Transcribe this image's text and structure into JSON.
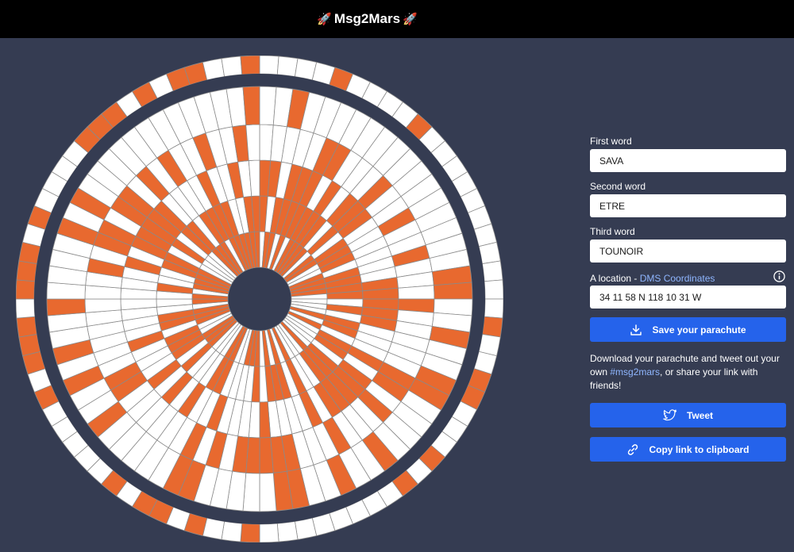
{
  "header": {
    "title": "Msg2Mars",
    "left_emoji": "🚀",
    "right_emoji": "🚀"
  },
  "form": {
    "first_word": {
      "label": "First word",
      "value": "SAVA"
    },
    "second_word": {
      "label": "Second word",
      "value": "ETRE"
    },
    "third_word": {
      "label": "Third word",
      "value": "TOUNOIR"
    },
    "location": {
      "label_prefix": "A location - ",
      "link_text": "DMS Coordinates",
      "value": "34 11 58 N 118 10 31 W"
    }
  },
  "actions": {
    "save_label": "Save your parachute",
    "info_prefix": "Download your parachute and tweet out your own ",
    "hashtag": "#msg2mars",
    "info_suffix": ", or share your link with friends!",
    "tweet_label": "Tweet",
    "copy_label": "Copy link to clipboard"
  },
  "colors": {
    "background": "#353c52",
    "header": "#000000",
    "canopy_orange": "#e8692f",
    "canopy_white": "#ffffff",
    "button_blue": "#2563eb",
    "link": "#8fb6ff"
  },
  "icons": {
    "rocket": "rocket-emoji",
    "info": "info-circle-icon",
    "download": "download-icon",
    "twitter": "twitter-bird-icon",
    "link": "chain-link-icon"
  }
}
